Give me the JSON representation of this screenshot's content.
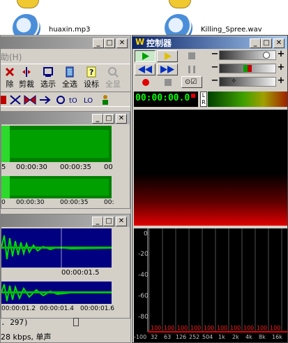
{
  "desktop": {
    "icon1_label": "huaxin.mp3",
    "icon2_label": "Killing_Spree.wav"
  },
  "editor": {
    "menu_fragment": "助(H)",
    "toolbar": [
      "除",
      "剪裁",
      "选示",
      "全选",
      "设标",
      "全显"
    ],
    "track1_ruler": [
      "5",
      "00:00:30",
      "00:00:35",
      "00"
    ],
    "track1_ruler2": [
      "0",
      "00:00:30",
      "00:00:35",
      "00:"
    ],
    "track2_ruler_top": "00:00:01.5",
    "track2_ruler_bottom": [
      "00:00:01.2",
      "00:00:01.4",
      "00:00:01.6"
    ],
    "status_value": ". 297)",
    "status_bitrate": "28 kbps, 单声"
  },
  "controller": {
    "title": "控制器",
    "time": "00:00:00.0",
    "lr_left": "L",
    "lr_right": "R",
    "db_labels": [
      "0",
      "-20",
      "-40",
      "-60",
      "-80",
      "-100"
    ],
    "freq_labels": [
      "-100",
      "32",
      "63",
      "126",
      "252",
      "504",
      "1k",
      "2k",
      "4k",
      "8k",
      "16k"
    ],
    "peak_values": [
      "100",
      "100",
      "100",
      "100",
      "100",
      "100",
      "100",
      "100",
      "100",
      "100"
    ],
    "colors": {
      "time_green": "#00ff00",
      "peak_red": "#ff2020",
      "accent_blue": "#0a246a"
    }
  }
}
